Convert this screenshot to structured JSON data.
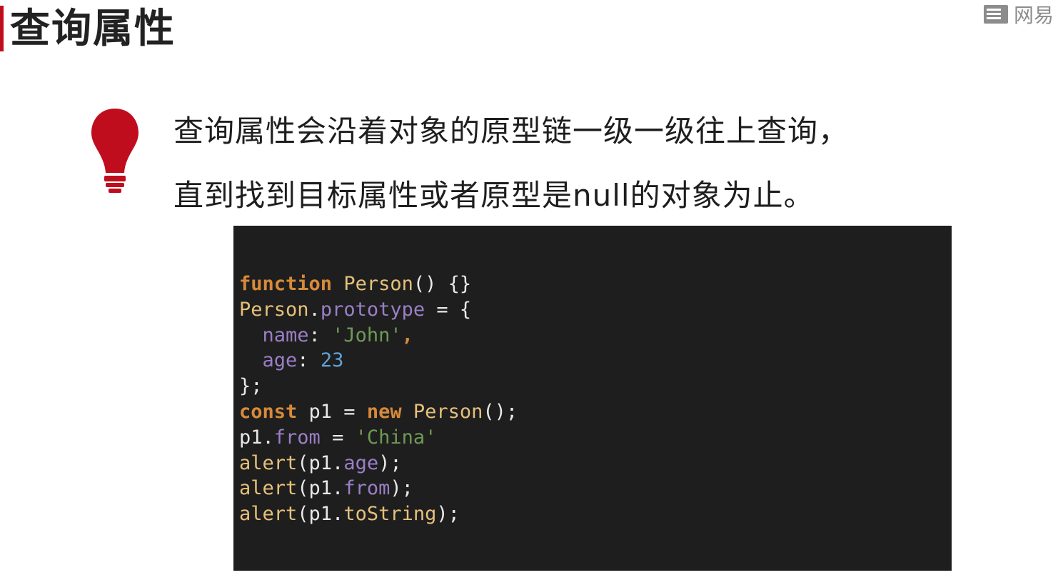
{
  "slide": {
    "title": "查询属性",
    "logo_text": "网易",
    "tip_lines": [
      "查询属性会沿着对象的原型链一级一级往上查询，",
      "直到找到目标属性或者原型是null的对象为止。"
    ]
  },
  "code": {
    "lines": [
      [
        {
          "t": "function",
          "c": "kw"
        },
        {
          "t": " ",
          "c": "pun"
        },
        {
          "t": "Person",
          "c": "fn"
        },
        {
          "t": "() {}",
          "c": "pun"
        }
      ],
      [
        {
          "t": "Person",
          "c": "fn"
        },
        {
          "t": ".",
          "c": "pun"
        },
        {
          "t": "prototype",
          "c": "prop"
        },
        {
          "t": " = {",
          "c": "pun"
        }
      ],
      [
        {
          "t": "  ",
          "c": "pun"
        },
        {
          "t": "name",
          "c": "prop"
        },
        {
          "t": ": ",
          "c": "pun"
        },
        {
          "t": "'John'",
          "c": "str"
        },
        {
          "t": ",",
          "c": "kw"
        }
      ],
      [
        {
          "t": "  ",
          "c": "pun"
        },
        {
          "t": "age",
          "c": "prop"
        },
        {
          "t": ": ",
          "c": "pun"
        },
        {
          "t": "23",
          "c": "num"
        }
      ],
      [
        {
          "t": "};",
          "c": "pun"
        }
      ],
      [
        {
          "t": "const",
          "c": "kw"
        },
        {
          "t": " p1 = ",
          "c": "pun"
        },
        {
          "t": "new",
          "c": "kw"
        },
        {
          "t": " ",
          "c": "pun"
        },
        {
          "t": "Person",
          "c": "fn"
        },
        {
          "t": "();",
          "c": "pun"
        }
      ],
      [
        {
          "t": "p1.",
          "c": "pun"
        },
        {
          "t": "from",
          "c": "prop"
        },
        {
          "t": " = ",
          "c": "pun"
        },
        {
          "t": "'China'",
          "c": "str"
        }
      ],
      [
        {
          "t": "alert",
          "c": "fn"
        },
        {
          "t": "(p1.",
          "c": "pun"
        },
        {
          "t": "age",
          "c": "prop"
        },
        {
          "t": ");",
          "c": "pun"
        }
      ],
      [
        {
          "t": "alert",
          "c": "fn"
        },
        {
          "t": "(p1.",
          "c": "pun"
        },
        {
          "t": "from",
          "c": "prop"
        },
        {
          "t": ");",
          "c": "pun"
        }
      ],
      [
        {
          "t": "alert",
          "c": "fn"
        },
        {
          "t": "(p1.",
          "c": "pun"
        },
        {
          "t": "toString",
          "c": "fn"
        },
        {
          "t": ");",
          "c": "pun"
        }
      ]
    ]
  },
  "icons": {
    "tip_icon": "lightbulb-icon",
    "logo_icon": "book-icon"
  },
  "colors": {
    "accent": "#c00d1e",
    "code_bg": "#1e1e1e"
  }
}
